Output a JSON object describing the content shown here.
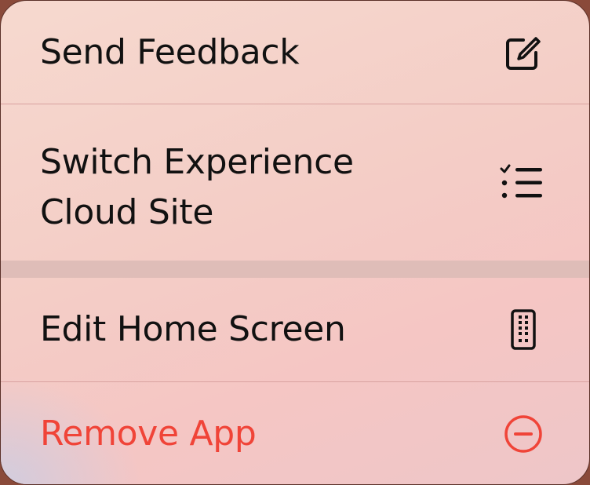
{
  "menu": {
    "items": [
      {
        "label": "Send Feedback",
        "icon": "compose-icon"
      },
      {
        "label_line1": "Switch Experience",
        "label_line2": "Cloud Site",
        "icon": "checklist-icon"
      },
      {
        "label": "Edit Home Screen",
        "icon": "phone-apps-icon"
      },
      {
        "label": "Remove App",
        "icon": "minus-circle-icon",
        "destructive": true
      }
    ]
  },
  "colors": {
    "text": "#111111",
    "destructive": "#f04438",
    "divider": "#d9a2a0",
    "section_gap": "#dfbdb8"
  }
}
